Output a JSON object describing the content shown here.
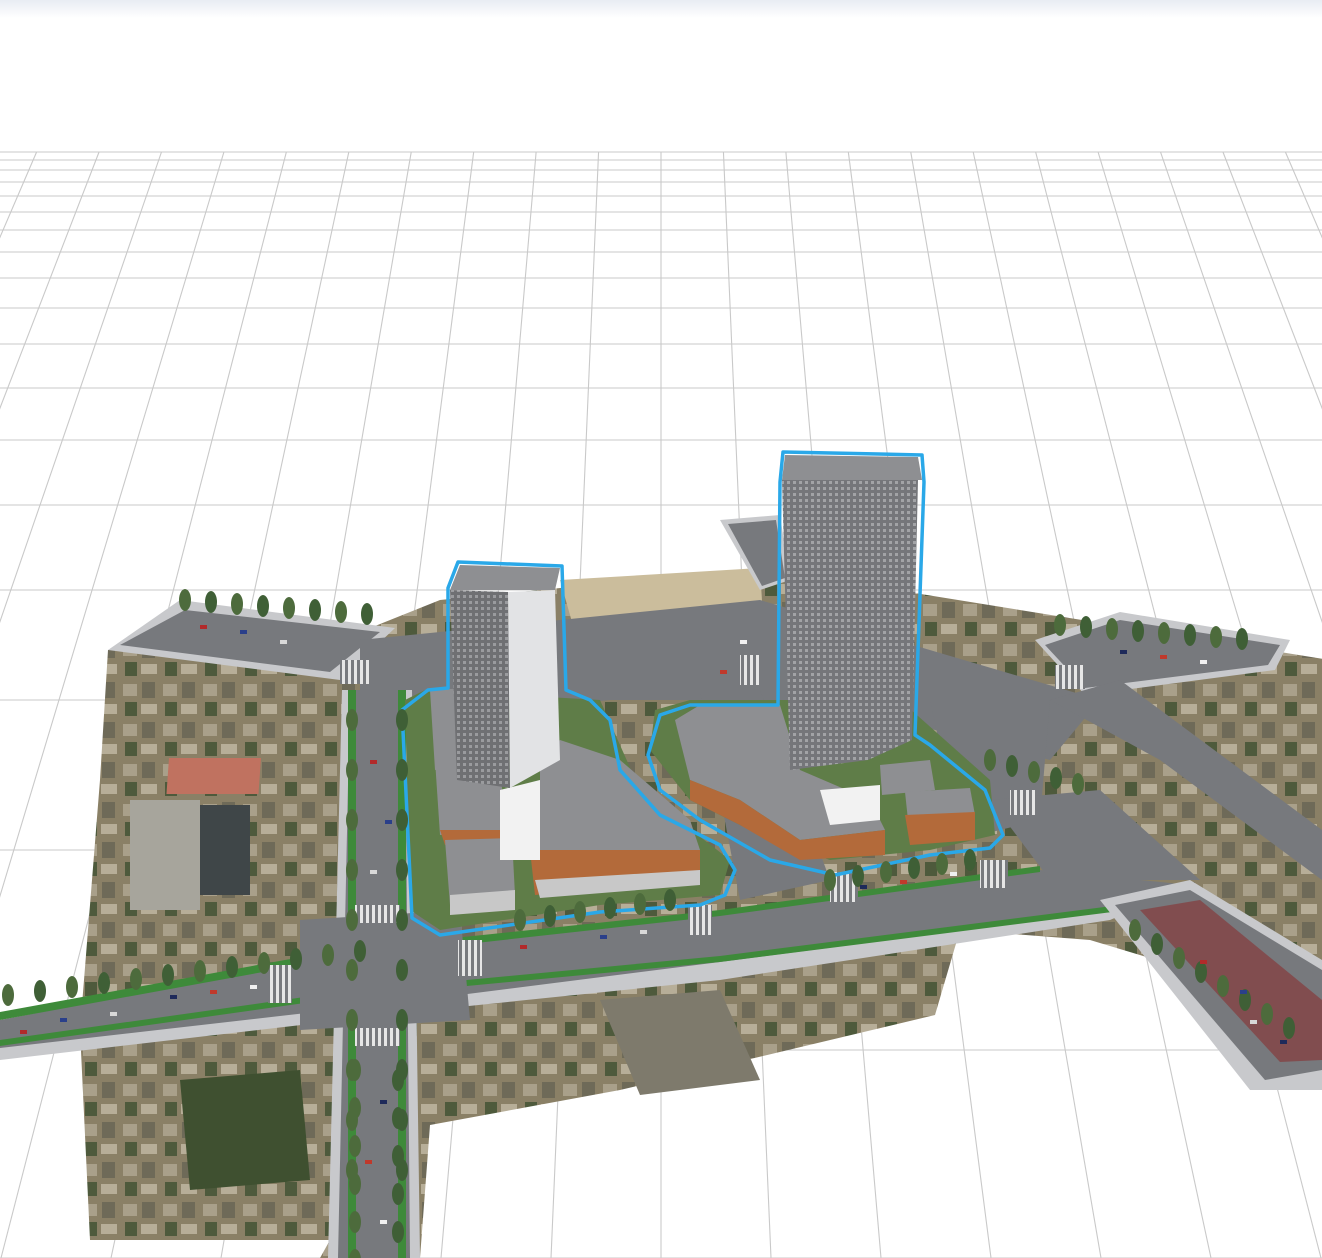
{
  "viewer": {
    "scene_name": "",
    "selection_color": "#2aa8e8",
    "ground_grid_color": "#c8c8c8",
    "selected_objects": [
      "tower-west",
      "tower-east",
      "podium-west",
      "podium-east"
    ]
  },
  "colors": {
    "road": "#77797d",
    "road_edge": "#c8c9cc",
    "green_strip": "#3e8a3a",
    "bike_lane": "#8a2a2a",
    "tower_face": "#7a7b7e",
    "tower_side": "#d9dadc",
    "roof": "#8e8f92",
    "landscape": "#5f7d48",
    "imagery": "#8a8066"
  }
}
